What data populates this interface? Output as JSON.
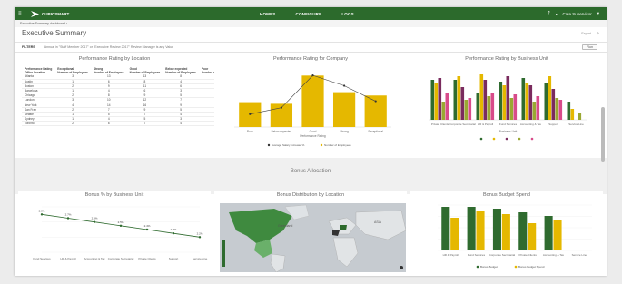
{
  "header": {
    "brand": "CUBICSMART",
    "nav": [
      "HOMES",
      "CONFIGURE",
      "LOGS"
    ],
    "user": "Cate Supervisor",
    "sub_label": "Executive Summary dashboard ›"
  },
  "page": {
    "title": "Executive Summary",
    "right_links": [
      "Export",
      "Edit"
    ]
  },
  "filters": {
    "label": "FILTERS",
    "text": "Annual in \"Staff Member 2017\" or \"Executive Review 2017\"   Review Manager is any Value",
    "button": "Run"
  },
  "panels": {
    "location_title": "Performance Rating by Location",
    "company_title": "Performance Rating for Company",
    "business_unit_title": "Performance Rating by Business Unit",
    "bonus_section": "Bonus Allocation",
    "bonus_pct_title": "Bonus % by Business Unit",
    "bonus_map_title": "Bonus Distribution by Location",
    "bonus_budget_title": "Bonus Budget Spend"
  },
  "location_table": {
    "header_top": [
      "Performance Rating",
      "Exceptional",
      "Strong",
      "Good",
      "Below expected",
      "Poor"
    ],
    "header_sub": [
      "Office Location",
      "Number of Employees",
      "Number of Employees",
      "Number of Employees",
      "Number of Employees",
      "Number of Employees"
    ],
    "rows": [
      [
        "Atlanta",
        "3",
        "13",
        "13",
        "8",
        "4"
      ],
      [
        "Austin",
        "1",
        "6",
        "8",
        "4",
        "2"
      ],
      [
        "Boston",
        "2",
        "9",
        "11",
        "6",
        "3"
      ],
      [
        "Barcelona",
        "1",
        "4",
        "6",
        "3",
        "1"
      ],
      [
        "Chicago",
        "2",
        "8",
        "9",
        "5",
        "2"
      ],
      [
        "London",
        "3",
        "10",
        "12",
        "7",
        "3"
      ],
      [
        "New York",
        "4",
        "14",
        "16",
        "9",
        "4"
      ],
      [
        "San Fran",
        "2",
        "7",
        "9",
        "5",
        "2"
      ],
      [
        "Seattle",
        "1",
        "5",
        "7",
        "4",
        "1"
      ],
      [
        "Sydney",
        "1",
        "4",
        "5",
        "3",
        "1"
      ],
      [
        "Toronto",
        "2",
        "6",
        "7",
        "4",
        "2"
      ]
    ]
  },
  "company_chart": {
    "categories": [
      "Poor",
      "Below expected",
      "Good",
      "Strong",
      "Exceptional"
    ],
    "bars": [
      30,
      28,
      62,
      42,
      38
    ],
    "line": [
      1.0,
      1.5,
      4.0,
      3.2,
      2.0
    ],
    "xlabel": "Performance Rating",
    "legend": [
      "Average Salary Increase %",
      "Number of Employees"
    ]
  },
  "business_unit_chart": {
    "categories": [
      "Private Clients",
      "Corporate Secretarial",
      "HR & Payroll",
      "Fund Services",
      "Accounting & Tax",
      "Support",
      "Service Line"
    ],
    "series_colors": [
      "#2f6b2f",
      "#e5b800",
      "#7a2b5e",
      "#9aa832",
      "#d84b8a"
    ],
    "xlabel": "Business Unit"
  },
  "bonus_pct_chart": {
    "categories": [
      "Fund Services",
      "HR & Payroll",
      "Accounting & Tax",
      "Corporate Secretarial",
      "Private Clients",
      "Support",
      "Service Line"
    ],
    "values": [
      2.8,
      2.7,
      2.6,
      2.5,
      2.4,
      2.3,
      2.2
    ]
  },
  "bonus_budget_chart": {
    "categories": [
      "HR & Payroll",
      "Fund Services",
      "Corporate Secretarial",
      "Private Clients",
      "Accounting & Tax",
      "Service Line"
    ],
    "legend": [
      "Bonus Budget",
      "Bonus Budget Spend"
    ]
  },
  "map": {
    "labels": [
      "Greenland",
      "ASIA"
    ],
    "scale_top": "high",
    "scale_bottom": "low"
  },
  "colors": {
    "header": "#2c6a2c",
    "gold": "#e5b800",
    "green": "#2f6b2f",
    "plum": "#7a2b5e"
  }
}
